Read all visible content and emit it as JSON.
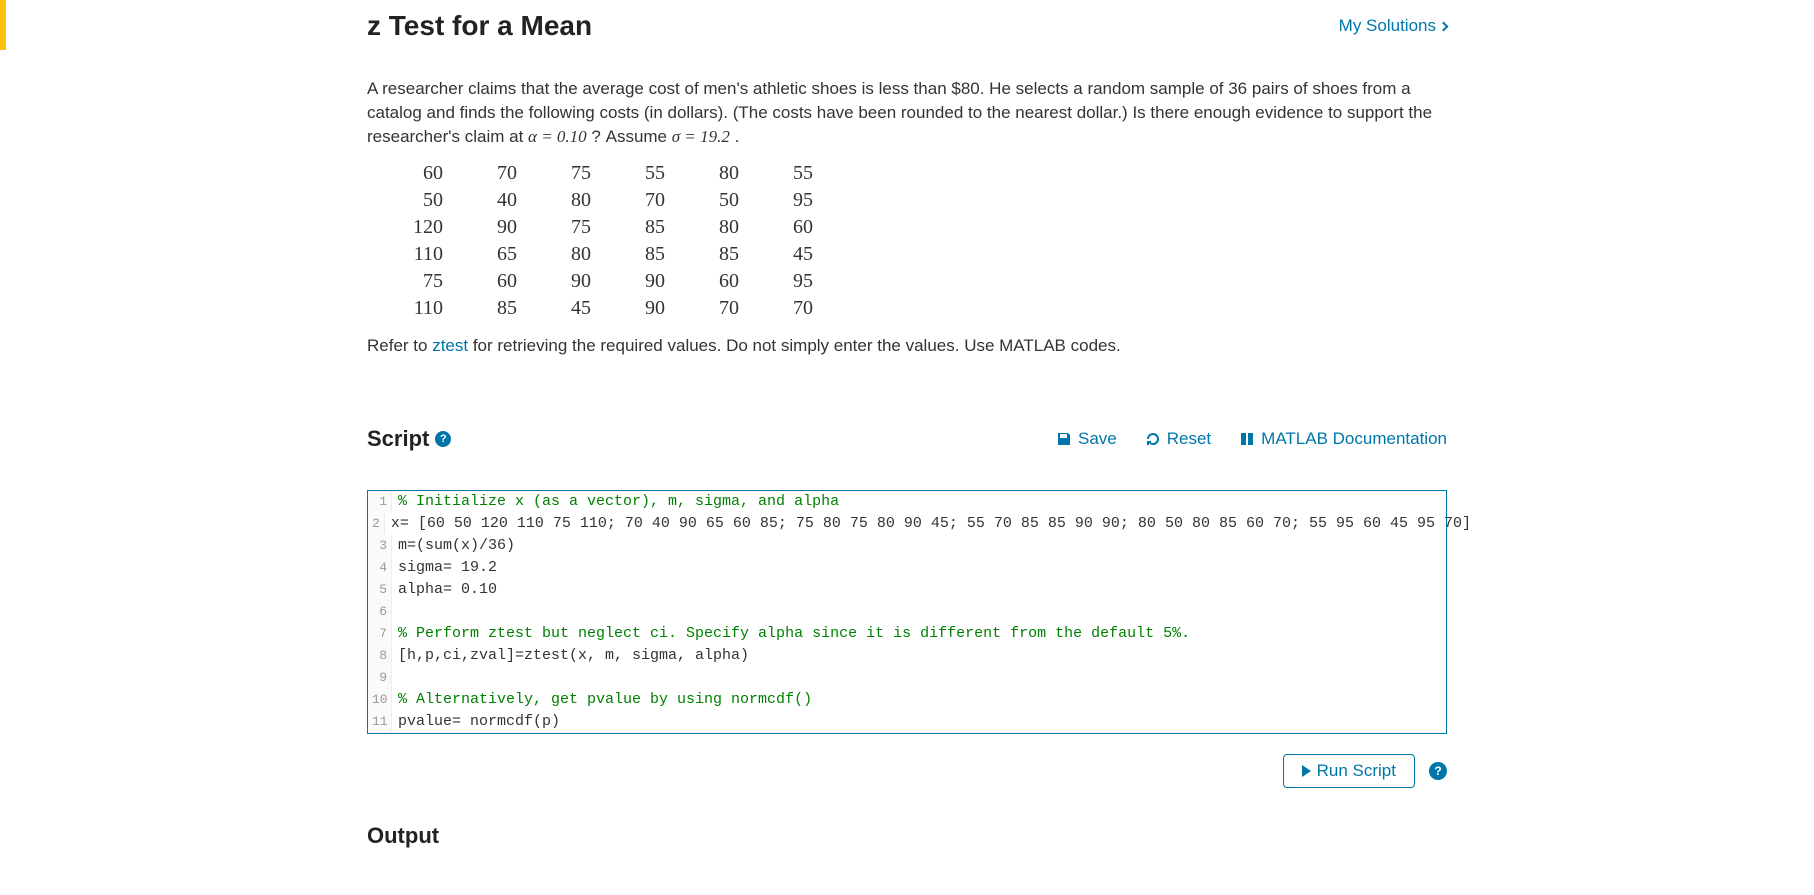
{
  "header": {
    "title": "z Test for a Mean",
    "my_solutions": "My Solutions"
  },
  "problem": {
    "text_before": "A researcher claims that the average cost of men's athletic shoes is less than $80. He selects a random sample of 36 pairs of shoes from a catalog and finds the following costs (in dollars). (The costs have been rounded to the nearest dollar.) Is there enough evidence to support the researcher's claim at ",
    "alpha_expr": "α = 0.10",
    "text_mid": "? Assume ",
    "sigma_expr": "σ = 19.2",
    "text_after": ".",
    "data": [
      [
        60,
        70,
        75,
        55,
        80,
        55
      ],
      [
        50,
        40,
        80,
        70,
        50,
        95
      ],
      [
        120,
        90,
        75,
        85,
        80,
        60
      ],
      [
        110,
        65,
        80,
        85,
        85,
        45
      ],
      [
        75,
        60,
        90,
        90,
        60,
        95
      ],
      [
        110,
        85,
        45,
        90,
        70,
        70
      ]
    ],
    "refer_before": "Refer to ",
    "refer_link": "ztest",
    "refer_after": " for retrieving the required values. Do not simply enter the values. Use MATLAB codes."
  },
  "script": {
    "title": "Script",
    "save": "Save",
    "reset": "Reset",
    "documentation": "MATLAB Documentation",
    "lines": [
      {
        "type": "comment",
        "text": "% Initialize x (as a vector), m, sigma, and alpha"
      },
      {
        "type": "code",
        "text": "x= [60 50 120 110 75 110; 70 40 90 65 60 85; 75 80 75 80 90 45; 55 70 85 85 90 90; 80 50 80 85 60 70; 55 95 60 45 95 70]"
      },
      {
        "type": "code",
        "text": "m=(sum(x)/36)"
      },
      {
        "type": "code",
        "text": "sigma= 19.2"
      },
      {
        "type": "code",
        "text": "alpha= 0.10"
      },
      {
        "type": "blank",
        "text": ""
      },
      {
        "type": "comment",
        "text": "% Perform ztest but neglect ci. Specify alpha since it is different from the default 5%."
      },
      {
        "type": "code",
        "text": "[h,p,ci,zval]=ztest(x, m, sigma, alpha)"
      },
      {
        "type": "blank",
        "text": ""
      },
      {
        "type": "comment",
        "text": "% Alternatively, get pvalue by using normcdf()"
      },
      {
        "type": "code",
        "text": "pvalue= normcdf(p)"
      }
    ],
    "run": "Run Script"
  },
  "output": {
    "title": "Output"
  }
}
